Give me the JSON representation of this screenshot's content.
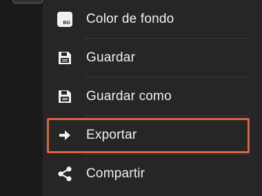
{
  "menu": {
    "items": [
      {
        "label": "Color de fondo",
        "icon": "background-color-icon",
        "badge_text": "BG"
      },
      {
        "label": "Guardar",
        "icon": "floppy-disk-icon"
      },
      {
        "label": "Guardar como",
        "icon": "floppy-disk-icon"
      },
      {
        "label": "Exportar",
        "icon": "arrow-right-icon",
        "highlighted": true
      },
      {
        "label": "Compartir",
        "icon": "share-icon"
      }
    ]
  },
  "colors": {
    "menu_background": "#262626",
    "page_background": "#1a1a1a",
    "highlight_border": "#d9643e",
    "text": "#f1f1f1"
  }
}
